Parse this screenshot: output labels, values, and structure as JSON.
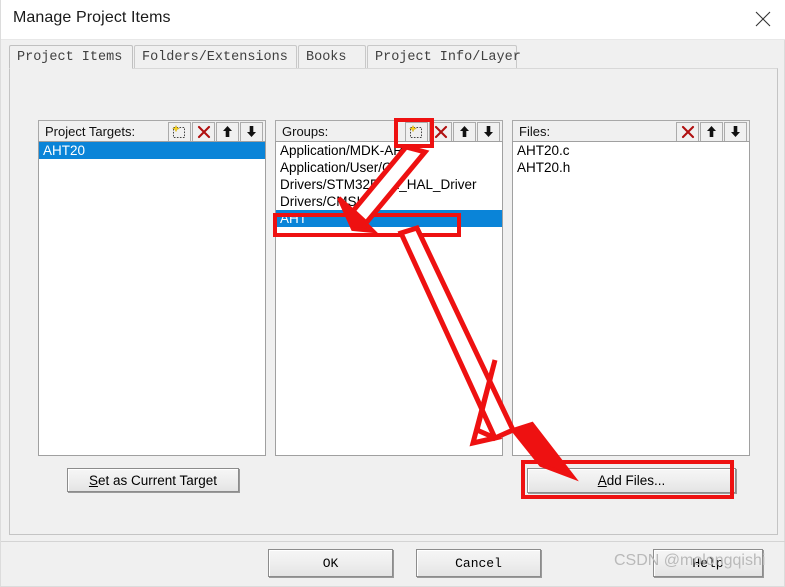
{
  "window": {
    "title": "Manage Project Items",
    "close_icon": "close-icon"
  },
  "tabs": [
    {
      "label": "Project Items",
      "active": true
    },
    {
      "label": "Folders/Extensions",
      "active": false
    },
    {
      "label": "Books",
      "active": false
    },
    {
      "label": "Project Info/Layer",
      "active": false
    }
  ],
  "panels": {
    "targets": {
      "label": "Project Targets:",
      "toolbar": [
        {
          "icon": "new-item-icon",
          "name": "new-target-button"
        },
        {
          "icon": "delete-x-icon",
          "name": "delete-target-button"
        },
        {
          "icon": "arrow-up-icon",
          "name": "move-target-up-button"
        },
        {
          "icon": "arrow-down-icon",
          "name": "move-target-down-button"
        }
      ],
      "items": [
        {
          "text": "AHT20",
          "selected": true
        }
      ]
    },
    "groups": {
      "label": "Groups:",
      "toolbar": [
        {
          "icon": "new-item-icon",
          "name": "new-group-button"
        },
        {
          "icon": "delete-x-icon",
          "name": "delete-group-button"
        },
        {
          "icon": "arrow-up-icon",
          "name": "move-group-up-button"
        },
        {
          "icon": "arrow-down-icon",
          "name": "move-group-down-button"
        }
      ],
      "items": [
        {
          "text": "Application/MDK-ARM",
          "selected": false
        },
        {
          "text": "Application/User/Core",
          "selected": false
        },
        {
          "text": "Drivers/STM32F1xx_HAL_Driver",
          "selected": false
        },
        {
          "text": "Drivers/CMSIS",
          "selected": false
        },
        {
          "text": "AHT",
          "selected": true
        }
      ]
    },
    "files": {
      "label": "Files:",
      "toolbar": [
        {
          "icon": "delete-x-icon",
          "name": "delete-file-button"
        },
        {
          "icon": "arrow-up-icon",
          "name": "move-file-up-button"
        },
        {
          "icon": "arrow-down-icon",
          "name": "move-file-down-button"
        }
      ],
      "items": [
        {
          "text": "AHT20.c",
          "selected": false
        },
        {
          "text": "AHT20.h",
          "selected": false
        }
      ]
    }
  },
  "buttons": {
    "set_current_target": {
      "accel": "S",
      "rest": "et as Current Target"
    },
    "add_files": {
      "accel": "A",
      "rest": "dd Files..."
    },
    "ok": "OK",
    "cancel": "Cancel",
    "help": "Help"
  },
  "watermark": "CSDN @molongqishi",
  "annotation": {
    "color": "#ee1111",
    "highlights": [
      "new-group-button",
      "groups-item-AHT",
      "add-files-button"
    ],
    "arrows": 2
  }
}
